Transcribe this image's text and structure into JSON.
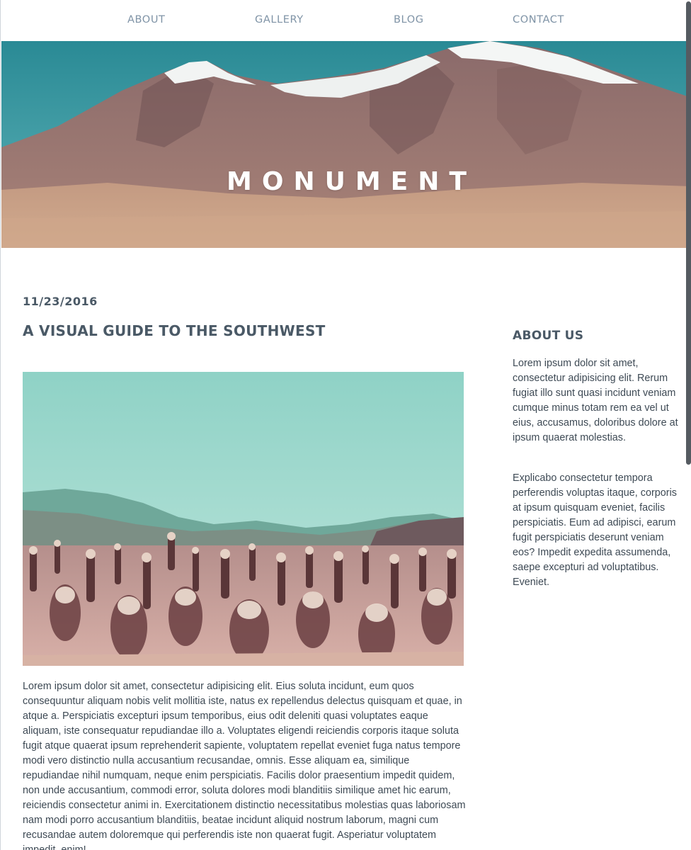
{
  "nav": {
    "items": [
      {
        "label": "ABOUT"
      },
      {
        "label": "GALLERY"
      },
      {
        "label": "BLOG"
      },
      {
        "label": "CONTACT"
      }
    ]
  },
  "hero": {
    "title": "MONUMENT"
  },
  "post": {
    "date": "11/23/2016",
    "title": "A VISUAL GUIDE TO THE SOUTHWEST",
    "body": "Lorem ipsum dolor sit amet, consectetur adipisicing elit. Eius soluta incidunt, eum quos consequuntur aliquam nobis velit mollitia iste, natus ex repellendus delectus quisquam et quae, in atque a. Perspiciatis excepturi ipsum temporibus, eius odit deleniti quasi voluptates eaque aliquam, iste consequatur repudiandae illo a. Voluptates eligendi reiciendis corporis itaque soluta fugit atque quaerat ipsum reprehenderit sapiente, voluptatem repellat eveniet fuga natus tempore modi vero distinctio nulla accusantium recusandae, omnis. Esse aliquam ea, similique repudiandae nihil numquam, neque enim perspiciatis. Facilis dolor praesentium impedit quidem, non unde accusantium, commodi error, soluta dolores modi blanditiis similique amet hic earum, reiciendis consectetur animi in. Exercitationem distinctio necessitatibus molestias quas laboriosam nam modi porro accusantium blanditiis, beatae incidunt aliquid nostrum laborum, magni cum recusandae autem doloremque qui perferendis iste non quaerat fugit. Asperiatur voluptatem impedit, enim!"
  },
  "sidebar": {
    "title": "ABOUT US",
    "paragraphs": [
      "Lorem ipsum dolor sit amet, consectetur adipisicing elit. Rerum fugiat illo sunt quasi incidunt veniam cumque minus totam rem ea vel ut eius, accusamus, doloribus dolore at ipsum quaerat molestias.",
      "Explicabo consectetur tempora perferendis voluptas itaque, corporis at ipsum quisquam eveniet, facilis perspiciatis. Eum ad adipisci, earum fugit perspiciatis deserunt veniam eos? Impedit expedita assumenda, saepe excepturi ad voluptatibus. Eveniet."
    ]
  },
  "colors": {
    "nav_text": "#7f93a6",
    "heading": "#4a5966",
    "body_text": "#3e4a55",
    "hero_sky": "#2f8f98",
    "desert_sky": "#9fd8cf"
  },
  "icons": {
    "scrollbar": "scrollbar-thumb"
  }
}
